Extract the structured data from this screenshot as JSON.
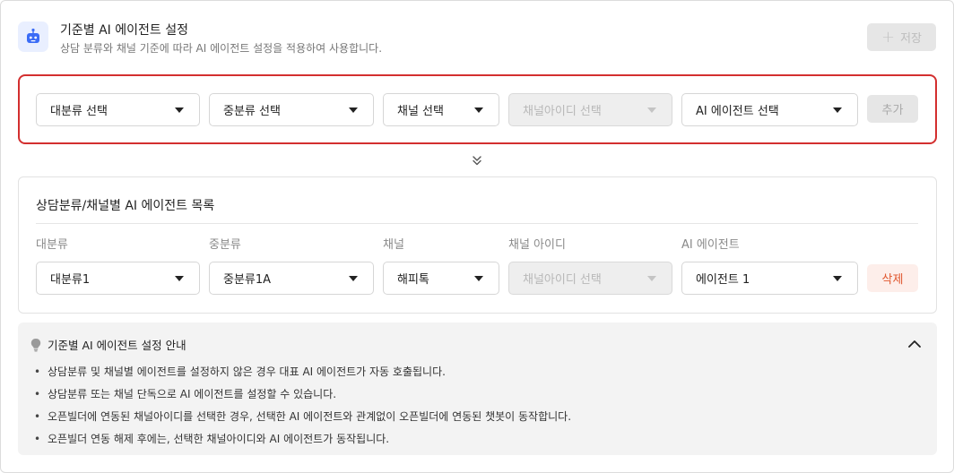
{
  "header": {
    "title": "기준별 AI 에이전트 설정",
    "subtitle": "상담 분류와 채널 기준에 따라 AI 에이전트 설정을 적용하여 사용합니다.",
    "save_label": "저장",
    "icon": "robot-icon"
  },
  "selector": {
    "major_category": "대분류 선택",
    "sub_category": "중분류 선택",
    "channel": "채널 선택",
    "channel_id": "채널아이디 선택",
    "agent": "AI 에이전트 선택",
    "add_label": "추가"
  },
  "list": {
    "title": "상담분류/채널별 AI 에이전트 목록",
    "columns": [
      "대분류",
      "중분류",
      "채널",
      "채널 아이디",
      "AI 에이전트"
    ],
    "rows": [
      {
        "major_category": "대분류1",
        "sub_category": "중분류1A",
        "channel": "해피톡",
        "channel_id": "채널아이디 선택",
        "agent": "에이전트 1",
        "delete_label": "삭제"
      }
    ]
  },
  "guide": {
    "title": "기준별 AI 에이전트 설정 안내",
    "items": [
      "상담분류 및 채널별 에이전트를 설정하지 않은 경우 대표 AI 에이전트가 자동 호출됩니다.",
      "상담분류 또는 채널 단독으로 AI 에이전트를 설정할 수 있습니다.",
      "오픈빌더에 연동된 채널아이디를 선택한 경우, 선택한 AI 에이전트와 관계없이 오픈빌더에 연동된 챗봇이 동작합니다.",
      "오픈빌더 연동 해제 후에는, 선택한 채널아이디와 AI 에이전트가 동작됩니다."
    ]
  },
  "colors": {
    "highlight_border": "#d32f2f",
    "delete_text": "#e0562d",
    "delete_bg": "#fdeeea",
    "icon_accent": "#3b6cf6"
  }
}
